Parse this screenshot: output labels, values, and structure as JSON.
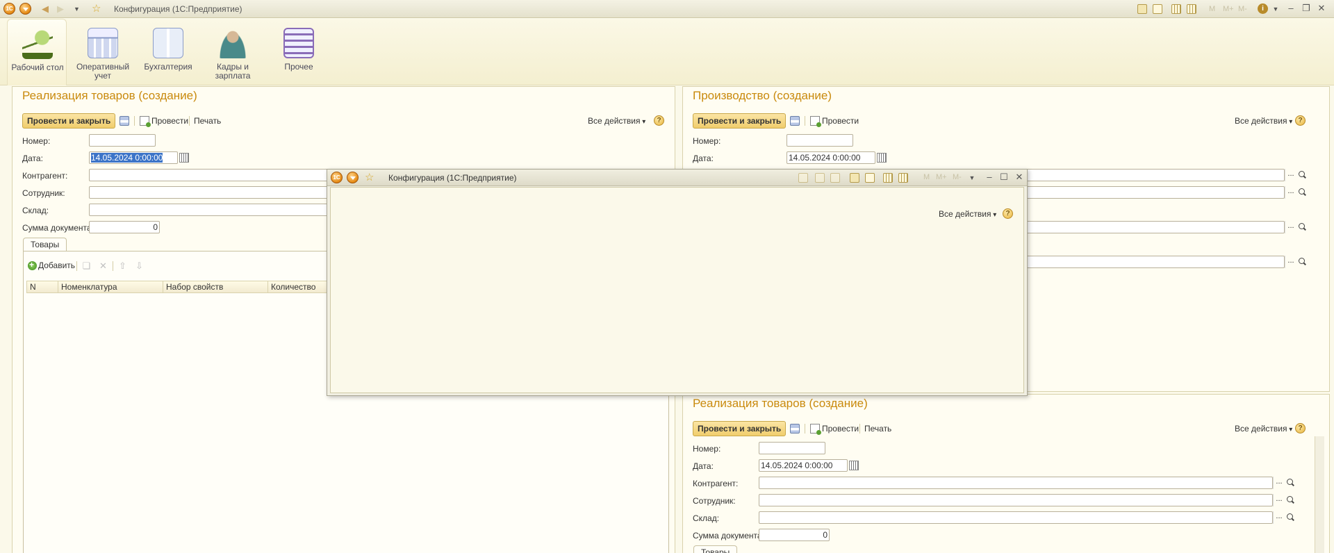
{
  "app": {
    "title": "Конфигурация  (1С:Предприятие)",
    "logo_text": "1C",
    "toolbar_labels": [
      "M",
      "M+",
      "M-"
    ]
  },
  "sections": [
    {
      "label": "Рабочий стол",
      "icon": "desk-lamp-icon"
    },
    {
      "label": "Оперативный учет",
      "icon": "calculator-icon"
    },
    {
      "label": "Бухгалтерия",
      "icon": "accounting-book-icon"
    },
    {
      "label": "Кадры и зарплата",
      "icon": "person-icon"
    },
    {
      "label": "Прочее",
      "icon": "list-icon"
    }
  ],
  "doc1": {
    "title": "Реализация товаров (создание)",
    "post_close": "Провести и закрыть",
    "post": "Провести",
    "print": "Печать",
    "all_actions": "Все действия",
    "help": "?",
    "labels": {
      "number": "Номер:",
      "date": "Дата:",
      "counterparty": "Контрагент:",
      "employee": "Сотрудник:",
      "warehouse": "Склад:",
      "sum": "Сумма документа:"
    },
    "values": {
      "number": "",
      "date": "14.05.2024  0:00:00",
      "sum": "0"
    },
    "tab": "Товары",
    "add": "Добавить",
    "columns": [
      "N",
      "Номенклатура",
      "Набор свойств",
      "Количество"
    ]
  },
  "doc2": {
    "title": "Производство (создание)",
    "post_close": "Провести и закрыть",
    "post": "Провести",
    "all_actions": "Все действия",
    "help": "?",
    "labels": {
      "number": "Номер:",
      "date": "Дата:"
    },
    "values": {
      "number": "",
      "date": "14.05.2024  0:00:00"
    }
  },
  "doc3": {
    "title": "Реализация товаров (создание)",
    "post_close": "Провести и закрыть",
    "post": "Провести",
    "print": "Печать",
    "all_actions": "Все действия",
    "help": "?",
    "labels": {
      "number": "Номер:",
      "date": "Дата:",
      "counterparty": "Контрагент:",
      "employee": "Сотрудник:",
      "warehouse": "Склад:",
      "sum": "Сумма документа:"
    },
    "values": {
      "number": "",
      "date": "14.05.2024  0:00:00",
      "sum": "0"
    },
    "tab": "Товары"
  },
  "float_window": {
    "title": "Конфигурация  (1С:Предприятие)",
    "all_actions": "Все действия",
    "help": "?"
  }
}
